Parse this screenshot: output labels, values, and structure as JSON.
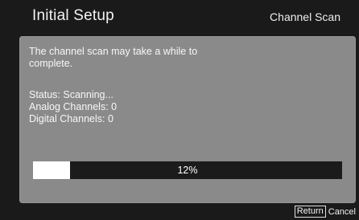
{
  "header": {
    "title": "Initial Setup",
    "section": "Channel Scan"
  },
  "panel": {
    "intro_line1": "The channel scan may take a while to",
    "intro_line2": "complete.",
    "status": "Status: Scanning...",
    "analog": "Analog Channels: 0",
    "digital": "Digital Channels: 0"
  },
  "progress": {
    "value": 0.12,
    "label": "12%",
    "fill_color": "#ffffff",
    "track_color": "#1b1b1b"
  },
  "footer": {
    "key_label": "Return",
    "action_label": "Cancel"
  }
}
